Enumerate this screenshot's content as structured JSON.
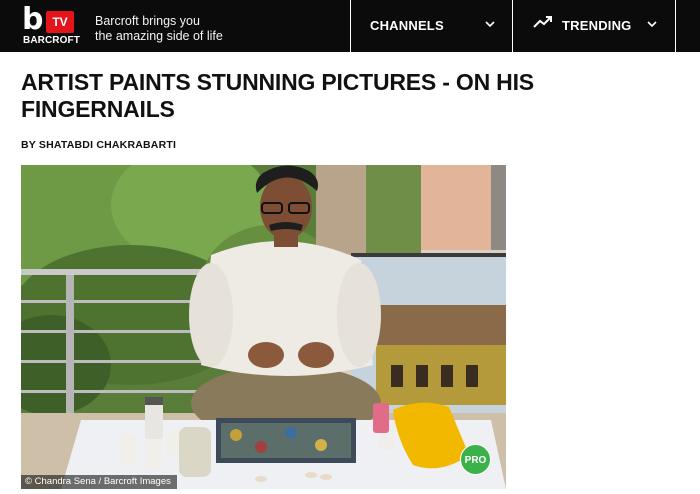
{
  "header": {
    "logo": {
      "letter": "b",
      "badge": "TV",
      "wordmark": "BARCROFT"
    },
    "tagline_line1": "Barcroft brings you",
    "tagline_line2": "the amazing side of life",
    "nav": {
      "channels_label": "CHANNELS",
      "trending_label": "TRENDING"
    },
    "icons": [
      "chevron-down-icon",
      "trending-up-icon",
      "chevron-down-icon"
    ]
  },
  "article": {
    "headline": "ARTIST PAINTS STUNNING PICTURES - ON HIS FINGERNAILS",
    "byline": "BY SHATABDI CHAKRABARTI",
    "photo": {
      "credit": "© Chandra Sena / Barcroft Images",
      "badge": "PRO"
    }
  },
  "colors": {
    "topbar": "#0b0b0b",
    "brand_red": "#e3151a",
    "pro_green": "#3bb14a"
  }
}
